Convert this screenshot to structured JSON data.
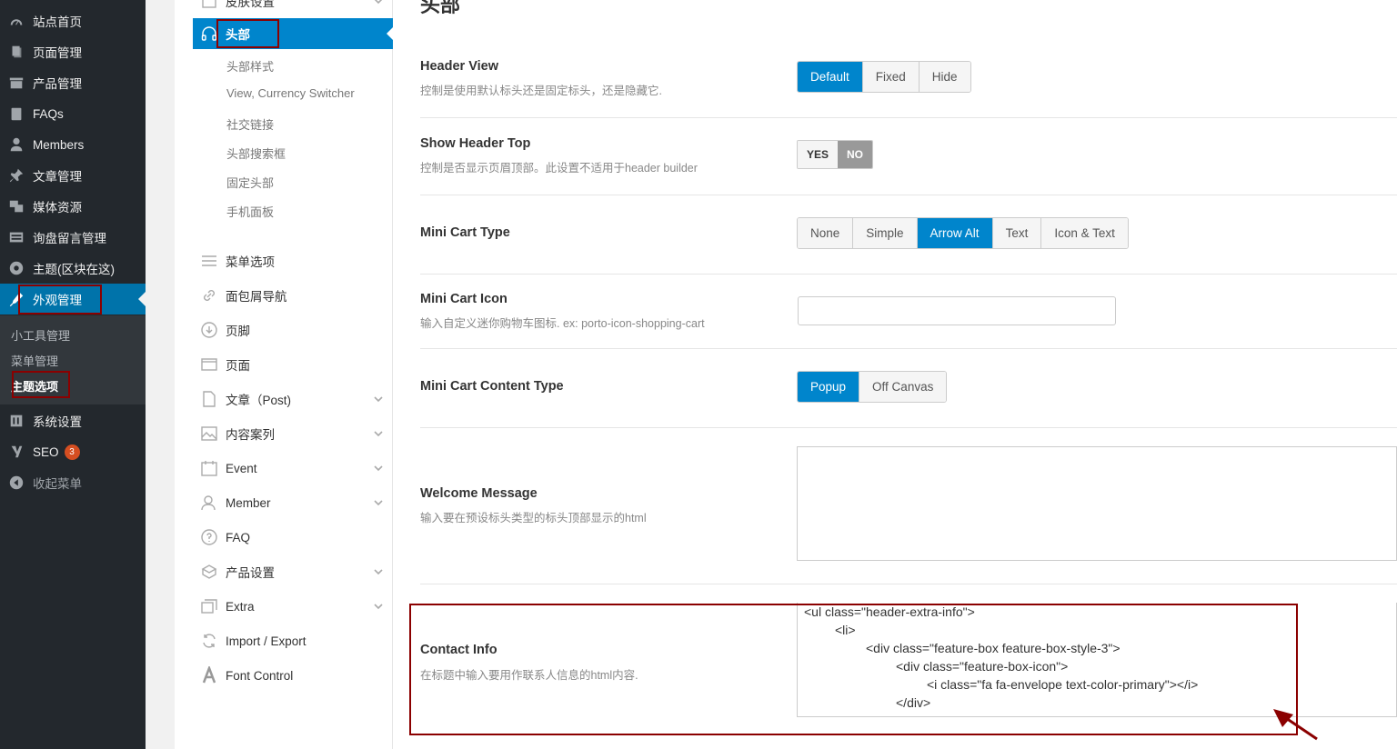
{
  "wp_menu": [
    {
      "icon": "dashboard-icon",
      "label": "站点首页"
    },
    {
      "icon": "pages-icon",
      "label": "页面管理"
    },
    {
      "icon": "products-icon",
      "label": "产品管理"
    },
    {
      "icon": "faq-book-icon",
      "label": "FAQs"
    },
    {
      "icon": "members-icon",
      "label": "Members"
    },
    {
      "icon": "pin-icon",
      "label": "文章管理"
    },
    {
      "icon": "media-icon",
      "label": "媒体资源"
    },
    {
      "icon": "inquiry-icon",
      "label": "询盘留言管理"
    },
    {
      "icon": "theme-icon",
      "label": "主题(区块在这)"
    },
    {
      "icon": "appearance-icon",
      "label": "外观管理"
    }
  ],
  "wp_submenu": [
    "小工具管理",
    "菜单管理",
    "主题选项"
  ],
  "wp_menu_bottom": [
    {
      "icon": "settings-icon",
      "label": "系统设置"
    },
    {
      "icon": "seo-icon",
      "label": "SEO",
      "badge": "3"
    },
    {
      "icon": "collapse-icon",
      "label": "收起菜单"
    }
  ],
  "options_nav": {
    "top_cut_label": "皮肤设置",
    "active": {
      "icon": "headphones-icon",
      "label": "头部"
    },
    "sub_items": [
      "头部样式",
      "View, Currency Switcher",
      "社交链接",
      "头部搜索框",
      "固定头部",
      "手机面板"
    ],
    "sections": [
      {
        "icon": "menu-icon",
        "label": "菜单选项",
        "chevron": false
      },
      {
        "icon": "link-icon",
        "label": "面包屑导航",
        "chevron": false
      },
      {
        "icon": "footer-icon",
        "label": "页脚",
        "chevron": false
      },
      {
        "icon": "page-icon",
        "label": "页面",
        "chevron": false
      },
      {
        "icon": "post-icon",
        "label": "文章（Post)",
        "chevron": true
      },
      {
        "icon": "portfolio-icon",
        "label": "内容案列",
        "chevron": true
      },
      {
        "icon": "event-icon",
        "label": "Event",
        "chevron": true
      },
      {
        "icon": "member-icon",
        "label": "Member",
        "chevron": true
      },
      {
        "icon": "faq-icon",
        "label": "FAQ",
        "chevron": false
      },
      {
        "icon": "product-settings-icon",
        "label": "产品设置",
        "chevron": true
      },
      {
        "icon": "extra-icon",
        "label": "Extra",
        "chevron": true
      },
      {
        "icon": "import-export-icon",
        "label": "Import / Export",
        "chevron": false
      },
      {
        "icon": "font-icon",
        "label": "Font Control",
        "chevron": false
      }
    ]
  },
  "content": {
    "section_title": "头部",
    "header_view": {
      "title": "Header View",
      "desc": "控制是使用默认标头还是固定标头，还是隐藏它.",
      "options": [
        "Default",
        "Fixed",
        "Hide"
      ],
      "selected": "Default"
    },
    "show_header_top": {
      "title": "Show Header Top",
      "desc": "控制是否显示页眉顶部。此设置不适用于header builder",
      "yes": "YES",
      "no": "NO",
      "value": "NO"
    },
    "mini_cart_type": {
      "title": "Mini Cart Type",
      "options": [
        "None",
        "Simple",
        "Arrow Alt",
        "Text",
        "Icon & Text"
      ],
      "selected": "Arrow Alt"
    },
    "mini_cart_icon": {
      "title": "Mini Cart Icon",
      "desc": "输入自定义迷你购物车图标. ex: porto-icon-shopping-cart",
      "value": ""
    },
    "mini_cart_content_type": {
      "title": "Mini Cart Content Type",
      "options": [
        "Popup",
        "Off Canvas"
      ],
      "selected": "Popup"
    },
    "welcome_message": {
      "title": "Welcome Message",
      "desc": "输入要在预设标头类型的标头顶部显示的html",
      "value": ""
    },
    "contact_info": {
      "title": "Contact Info",
      "desc": "在标题中输入要用作联系人信息的html内容.",
      "code_lines": [
        "<ul class=\"header-extra-info\">",
        "<li>",
        "<div class=\"feature-box feature-box-style-3\">",
        "<div class=\"feature-box-icon\">",
        "<i class=\"fa fa-envelope text-color-primary\"></i>",
        "</div>"
      ]
    }
  },
  "colors": {
    "accent": "#0085cc",
    "wp_sidebar": "#23282d",
    "highlight_box": "#8b0000"
  }
}
